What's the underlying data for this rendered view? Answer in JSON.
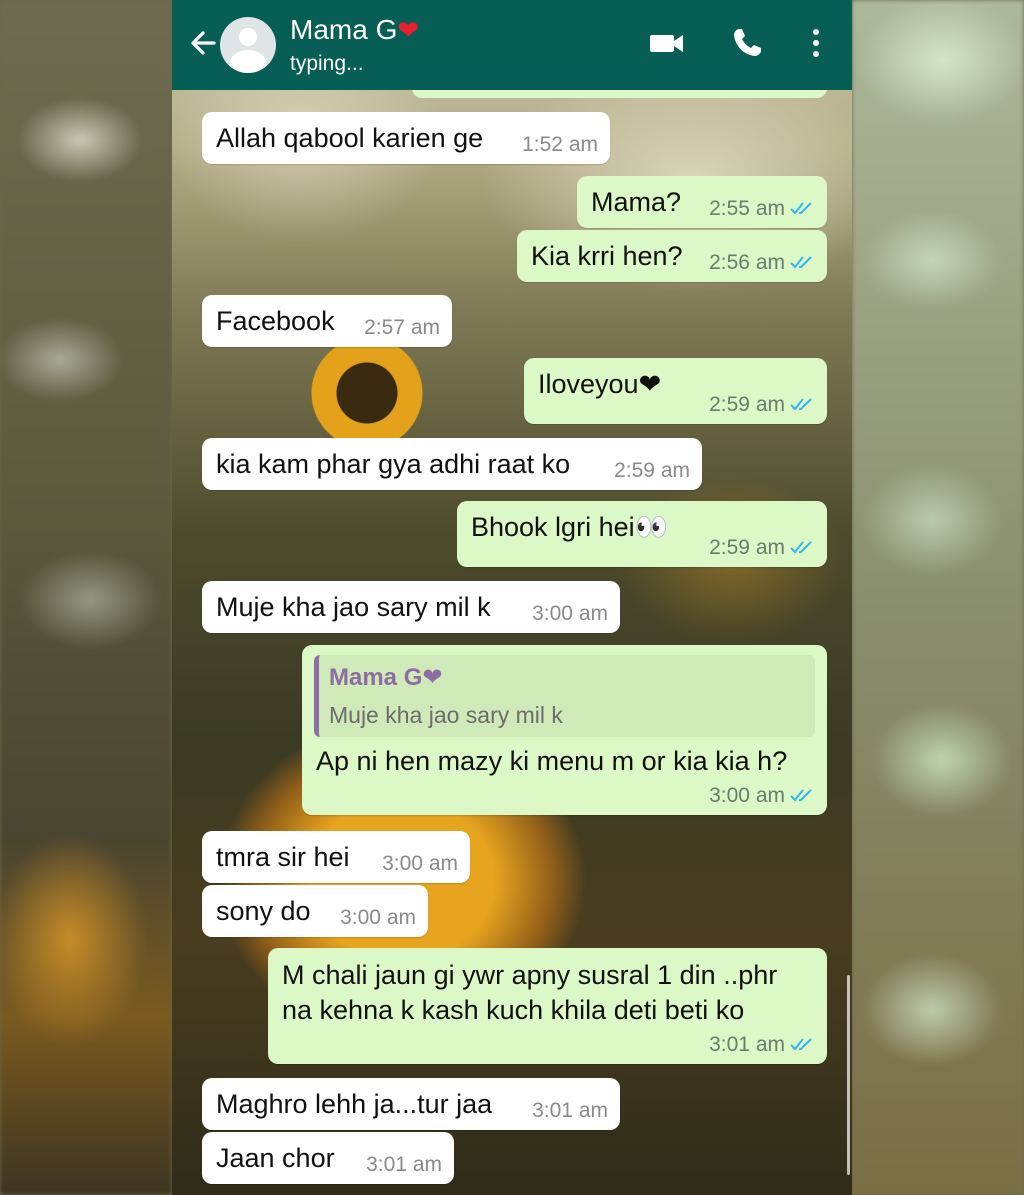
{
  "header": {
    "name": "Mama G",
    "name_emoji": "❤",
    "status": "typing..."
  },
  "messages": [
    {
      "dir": "in",
      "text": "Allah qabool karien ge",
      "time": "1:52 am"
    },
    {
      "dir": "out",
      "text": "Mama?",
      "time": "2:55 am"
    },
    {
      "dir": "out",
      "text": "Kia krri hen?",
      "time": "2:56 am"
    },
    {
      "dir": "in",
      "text": "Facebook",
      "time": "2:57 am"
    },
    {
      "dir": "out",
      "text": "Iloveyou❤",
      "time": "2:59 am"
    },
    {
      "dir": "in",
      "text": "kia kam phar gya adhi raat ko",
      "time": "2:59 am"
    },
    {
      "dir": "out",
      "text": "Bhook lgri hei👀",
      "time": "2:59 am"
    },
    {
      "dir": "in",
      "text": "Muje kha jao sary mil k",
      "time": "3:00 am"
    },
    {
      "dir": "out",
      "quote_name": "Mama G❤",
      "quote_text": "Muje kha jao sary mil k",
      "text": "Ap ni hen mazy ki menu m or kia kia h?",
      "time": "3:00 am"
    },
    {
      "dir": "in",
      "text": "tmra sir hei",
      "time": "3:00 am"
    },
    {
      "dir": "in",
      "text": "sony do",
      "time": "3:00 am"
    },
    {
      "dir": "out",
      "text_lines": [
        "M chali jaun gi ywr apny susral 1 din ..phr",
        "na kehna k kash kuch khila deti beti ko"
      ],
      "time": "3:01 am"
    },
    {
      "dir": "in",
      "text": "Maghro lehh ja...tur jaa",
      "time": "3:01 am"
    },
    {
      "dir": "in",
      "text": "Jaan chor",
      "time": "3:01 am"
    }
  ],
  "colors": {
    "header": "#075e54",
    "outgoing_bubble": "#dcf8c6",
    "incoming_bubble": "#ffffff",
    "read_tick": "#34b7f1"
  },
  "icons": [
    "back-arrow-icon",
    "avatar-placeholder-icon",
    "video-call-icon",
    "voice-call-icon",
    "more-options-icon",
    "double-tick-icon"
  ]
}
